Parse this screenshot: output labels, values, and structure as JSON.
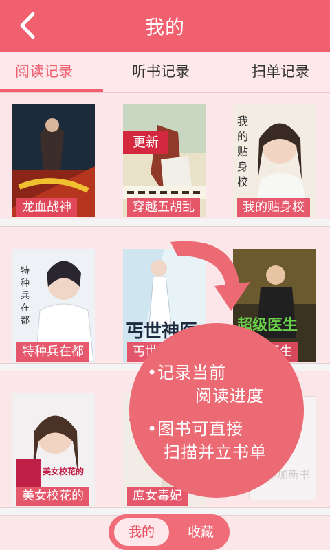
{
  "header": {
    "title": "我的",
    "back_icon": "chevron-left-icon"
  },
  "tabs": [
    {
      "label": "阅读记录",
      "active": true
    },
    {
      "label": "听书记录",
      "active": false
    },
    {
      "label": "扫单记录",
      "active": false
    }
  ],
  "books": [
    {
      "title": "龙血战神"
    },
    {
      "title": "穿越五胡乱",
      "badge": "更新"
    },
    {
      "title": "我的贴身校"
    },
    {
      "title": "特种兵在都"
    },
    {
      "title": "丐世神医"
    },
    {
      "title": "超级医生"
    },
    {
      "title": "美女校花的"
    },
    {
      "title": "庶女毒妃"
    }
  ],
  "overlay": {
    "tip1_line1": "•记录当前",
    "tip1_line2": "阅读进度",
    "tip2_line1": "•图书可直接",
    "tip2_line2": "扫描并立书单",
    "ghost_text": "添加新书"
  },
  "bottom_switch": {
    "mine": "我的",
    "favorites": "收藏",
    "selected": "我的"
  },
  "colors": {
    "accent": "#f0606f",
    "tab_bg": "#fde8ec",
    "label_bg": "#e44a60",
    "badge_bg": "#d4283e"
  }
}
